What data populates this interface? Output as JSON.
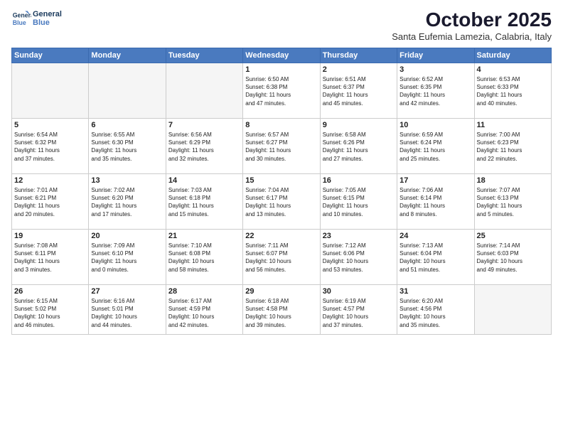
{
  "logo": {
    "line1": "General",
    "line2": "Blue"
  },
  "title": "October 2025",
  "subtitle": "Santa Eufemia Lamezia, Calabria, Italy",
  "days_of_week": [
    "Sunday",
    "Monday",
    "Tuesday",
    "Wednesday",
    "Thursday",
    "Friday",
    "Saturday"
  ],
  "weeks": [
    [
      {
        "day": "",
        "empty": true
      },
      {
        "day": "",
        "empty": true
      },
      {
        "day": "",
        "empty": true
      },
      {
        "day": "1",
        "info": "Sunrise: 6:50 AM\nSunset: 6:38 PM\nDaylight: 11 hours\nand 47 minutes."
      },
      {
        "day": "2",
        "info": "Sunrise: 6:51 AM\nSunset: 6:37 PM\nDaylight: 11 hours\nand 45 minutes."
      },
      {
        "day": "3",
        "info": "Sunrise: 6:52 AM\nSunset: 6:35 PM\nDaylight: 11 hours\nand 42 minutes."
      },
      {
        "day": "4",
        "info": "Sunrise: 6:53 AM\nSunset: 6:33 PM\nDaylight: 11 hours\nand 40 minutes."
      }
    ],
    [
      {
        "day": "5",
        "info": "Sunrise: 6:54 AM\nSunset: 6:32 PM\nDaylight: 11 hours\nand 37 minutes."
      },
      {
        "day": "6",
        "info": "Sunrise: 6:55 AM\nSunset: 6:30 PM\nDaylight: 11 hours\nand 35 minutes."
      },
      {
        "day": "7",
        "info": "Sunrise: 6:56 AM\nSunset: 6:29 PM\nDaylight: 11 hours\nand 32 minutes."
      },
      {
        "day": "8",
        "info": "Sunrise: 6:57 AM\nSunset: 6:27 PM\nDaylight: 11 hours\nand 30 minutes."
      },
      {
        "day": "9",
        "info": "Sunrise: 6:58 AM\nSunset: 6:26 PM\nDaylight: 11 hours\nand 27 minutes."
      },
      {
        "day": "10",
        "info": "Sunrise: 6:59 AM\nSunset: 6:24 PM\nDaylight: 11 hours\nand 25 minutes."
      },
      {
        "day": "11",
        "info": "Sunrise: 7:00 AM\nSunset: 6:23 PM\nDaylight: 11 hours\nand 22 minutes."
      }
    ],
    [
      {
        "day": "12",
        "info": "Sunrise: 7:01 AM\nSunset: 6:21 PM\nDaylight: 11 hours\nand 20 minutes."
      },
      {
        "day": "13",
        "info": "Sunrise: 7:02 AM\nSunset: 6:20 PM\nDaylight: 11 hours\nand 17 minutes."
      },
      {
        "day": "14",
        "info": "Sunrise: 7:03 AM\nSunset: 6:18 PM\nDaylight: 11 hours\nand 15 minutes."
      },
      {
        "day": "15",
        "info": "Sunrise: 7:04 AM\nSunset: 6:17 PM\nDaylight: 11 hours\nand 13 minutes."
      },
      {
        "day": "16",
        "info": "Sunrise: 7:05 AM\nSunset: 6:15 PM\nDaylight: 11 hours\nand 10 minutes."
      },
      {
        "day": "17",
        "info": "Sunrise: 7:06 AM\nSunset: 6:14 PM\nDaylight: 11 hours\nand 8 minutes."
      },
      {
        "day": "18",
        "info": "Sunrise: 7:07 AM\nSunset: 6:13 PM\nDaylight: 11 hours\nand 5 minutes."
      }
    ],
    [
      {
        "day": "19",
        "info": "Sunrise: 7:08 AM\nSunset: 6:11 PM\nDaylight: 11 hours\nand 3 minutes."
      },
      {
        "day": "20",
        "info": "Sunrise: 7:09 AM\nSunset: 6:10 PM\nDaylight: 11 hours\nand 0 minutes."
      },
      {
        "day": "21",
        "info": "Sunrise: 7:10 AM\nSunset: 6:08 PM\nDaylight: 10 hours\nand 58 minutes."
      },
      {
        "day": "22",
        "info": "Sunrise: 7:11 AM\nSunset: 6:07 PM\nDaylight: 10 hours\nand 56 minutes."
      },
      {
        "day": "23",
        "info": "Sunrise: 7:12 AM\nSunset: 6:06 PM\nDaylight: 10 hours\nand 53 minutes."
      },
      {
        "day": "24",
        "info": "Sunrise: 7:13 AM\nSunset: 6:04 PM\nDaylight: 10 hours\nand 51 minutes."
      },
      {
        "day": "25",
        "info": "Sunrise: 7:14 AM\nSunset: 6:03 PM\nDaylight: 10 hours\nand 49 minutes."
      }
    ],
    [
      {
        "day": "26",
        "info": "Sunrise: 6:15 AM\nSunset: 5:02 PM\nDaylight: 10 hours\nand 46 minutes."
      },
      {
        "day": "27",
        "info": "Sunrise: 6:16 AM\nSunset: 5:01 PM\nDaylight: 10 hours\nand 44 minutes."
      },
      {
        "day": "28",
        "info": "Sunrise: 6:17 AM\nSunset: 4:59 PM\nDaylight: 10 hours\nand 42 minutes."
      },
      {
        "day": "29",
        "info": "Sunrise: 6:18 AM\nSunset: 4:58 PM\nDaylight: 10 hours\nand 39 minutes."
      },
      {
        "day": "30",
        "info": "Sunrise: 6:19 AM\nSunset: 4:57 PM\nDaylight: 10 hours\nand 37 minutes."
      },
      {
        "day": "31",
        "info": "Sunrise: 6:20 AM\nSunset: 4:56 PM\nDaylight: 10 hours\nand 35 minutes."
      },
      {
        "day": "",
        "empty": true
      }
    ]
  ]
}
